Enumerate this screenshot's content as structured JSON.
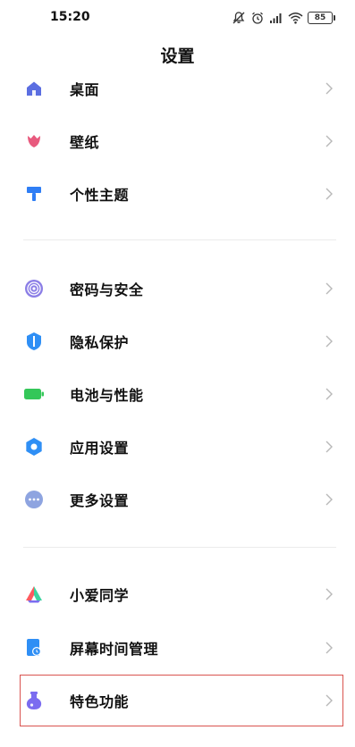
{
  "status_bar": {
    "time": "15:20",
    "battery_level": "85",
    "icons": [
      "notifications-off-icon",
      "alarm-icon",
      "signal-icon",
      "wifi-icon",
      "battery-icon"
    ]
  },
  "header": {
    "title": "设置"
  },
  "sections": [
    {
      "items": [
        {
          "label": "桌面",
          "icon": "home-icon",
          "color": "#5b6ee1"
        },
        {
          "label": "壁纸",
          "icon": "tulip-icon",
          "color": "#e85a7e"
        },
        {
          "label": "个性主题",
          "icon": "paint-roller-icon",
          "color": "#2f7ef5"
        }
      ]
    },
    {
      "items": [
        {
          "label": "密码与安全",
          "icon": "fingerprint-icon",
          "color": "#8b7ee6"
        },
        {
          "label": "隐私保护",
          "icon": "shield-icon",
          "color": "#2f8ff5"
        },
        {
          "label": "电池与性能",
          "icon": "battery-icon",
          "color": "#34c759"
        },
        {
          "label": "应用设置",
          "icon": "gear-icon",
          "color": "#2f8ff5"
        },
        {
          "label": "更多设置",
          "icon": "more-icon",
          "color": "#8ea4e0"
        }
      ]
    },
    {
      "items": [
        {
          "label": "小爱同学",
          "icon": "xiaoai-icon",
          "color": "#ff5a5f"
        },
        {
          "label": "屏幕时间管理",
          "icon": "screen-time-icon",
          "color": "#2f8ff5"
        },
        {
          "label": "特色功能",
          "icon": "flask-icon",
          "color": "#7b6cf0"
        }
      ]
    }
  ],
  "highlight_color": "#d9534f"
}
